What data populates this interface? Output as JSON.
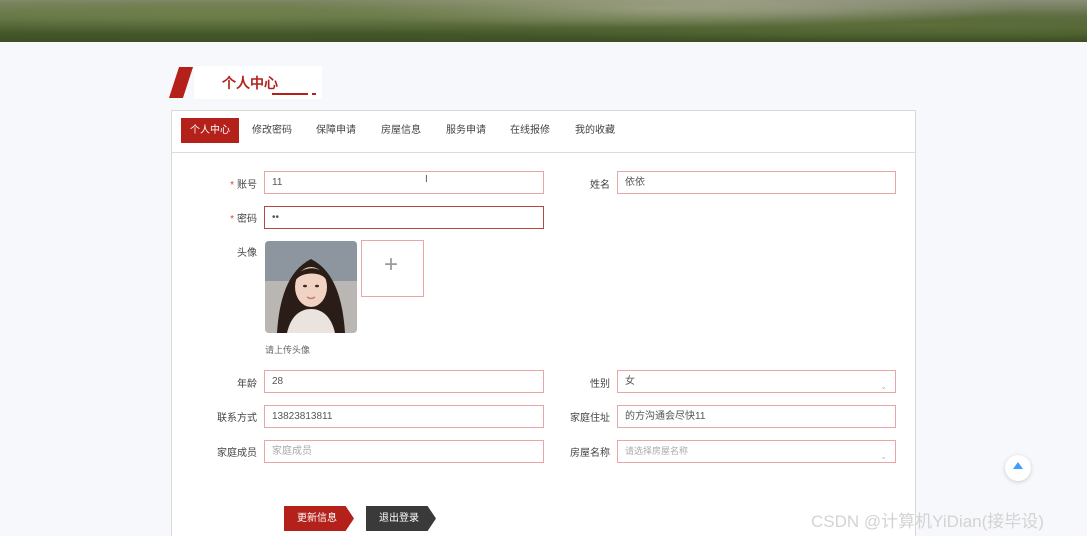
{
  "section_title": "个人中心",
  "tabs": [
    {
      "label": "个人中心",
      "active": true
    },
    {
      "label": "修改密码",
      "active": false
    },
    {
      "label": "保障申请",
      "active": false
    },
    {
      "label": "房屋信息",
      "active": false
    },
    {
      "label": "服务申请",
      "active": false
    },
    {
      "label": "在线报修",
      "active": false
    },
    {
      "label": "我的收藏",
      "active": false
    }
  ],
  "form": {
    "account": {
      "label": "账号",
      "value": "11",
      "required": "*"
    },
    "name": {
      "label": "姓名",
      "value": "依依"
    },
    "password": {
      "label": "密码",
      "value": "••",
      "required": "*"
    },
    "avatar": {
      "label": "头像",
      "hint": "请上传头像",
      "plus": "+"
    },
    "age": {
      "label": "年龄",
      "value": "28"
    },
    "gender": {
      "label": "性别",
      "value": "女"
    },
    "phone": {
      "label": "联系方式",
      "value": "13823813811"
    },
    "address": {
      "label": "家庭住址",
      "value": "的方沟通会尽快11"
    },
    "family": {
      "label": "家庭成员",
      "placeholder": "家庭成员"
    },
    "house": {
      "label": "房屋名称",
      "placeholder": "请选择房屋名称"
    }
  },
  "buttons": {
    "update": "更新信息",
    "logout": "退出登录"
  },
  "text_cursor": "I",
  "watermark": "CSDN @计算机YiDian(接毕设)",
  "colors": {
    "accent": "#b4211b",
    "input_border": "#e8a6a6",
    "scroll_top_arrow": "#409eff"
  }
}
